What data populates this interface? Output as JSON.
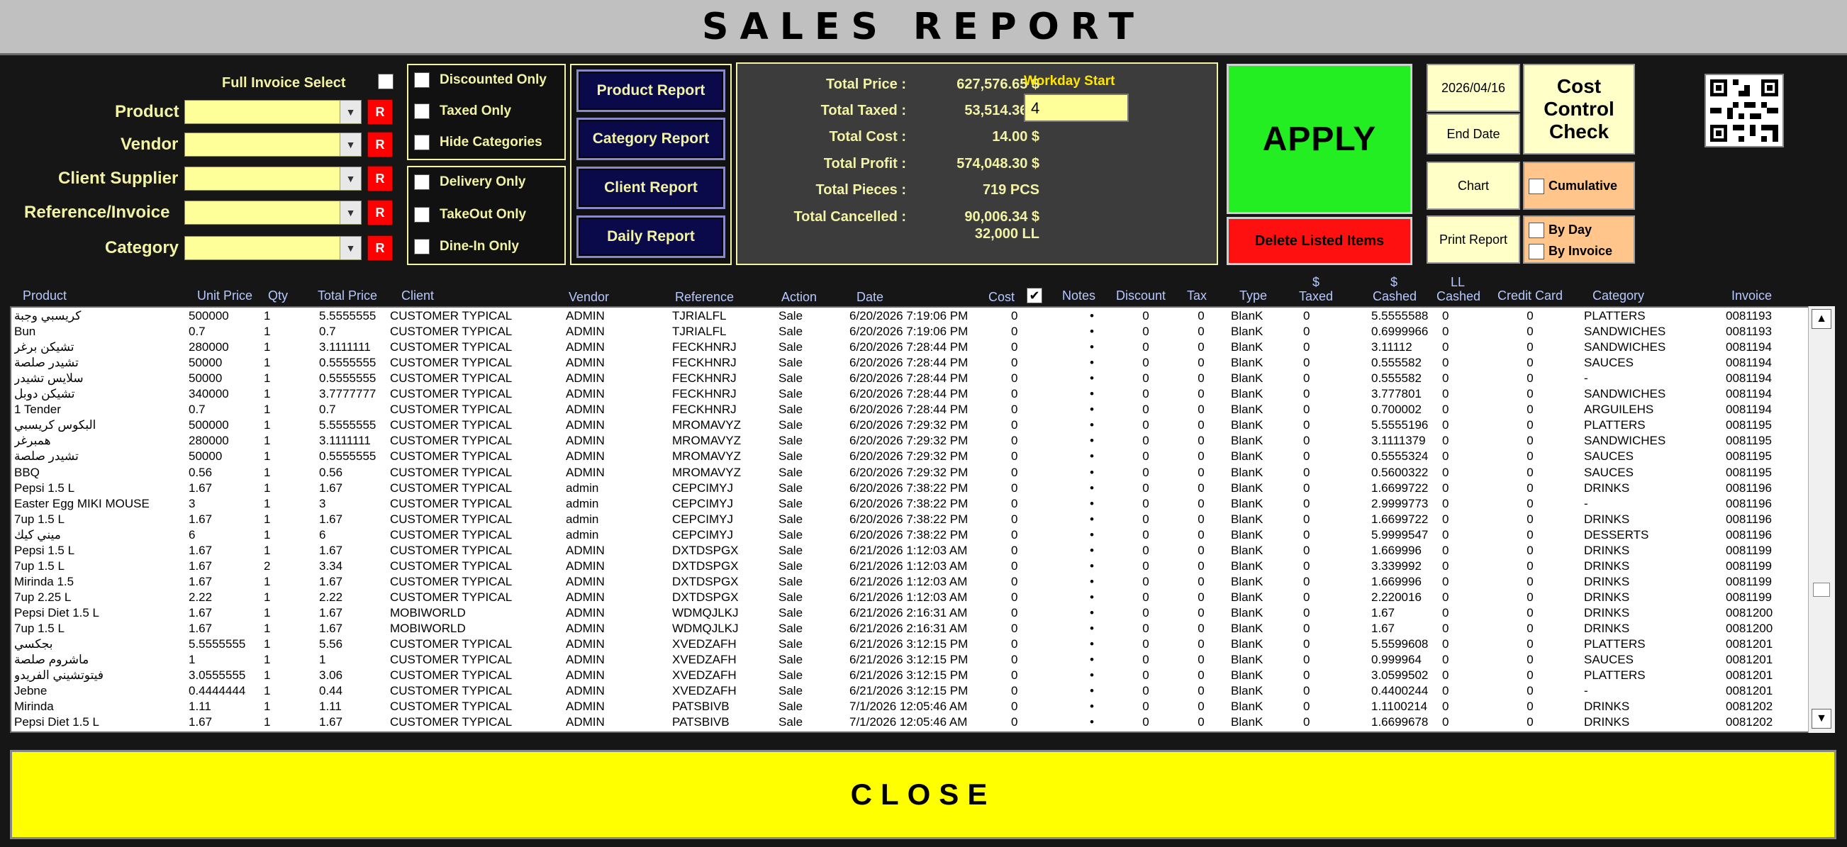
{
  "title": "SALES REPORT",
  "filters": {
    "full_invoice_select": "Full Invoice Select",
    "product": "Product",
    "vendor": "Vendor",
    "client_supplier": "Client Supplier",
    "reference_invoice": "Reference/Invoice",
    "category": "Category",
    "reset_label": "R"
  },
  "checks_group1": [
    "Discounted Only",
    "Taxed Only",
    "Hide Categories"
  ],
  "checks_group2": [
    "Delivery Only",
    "TakeOut Only",
    "Dine-In Only"
  ],
  "reports": [
    "Product Report",
    "Category Report",
    "Client Report",
    "Daily Report"
  ],
  "totals": {
    "price_label": "Total Price :",
    "price": "627,576.65 $",
    "taxed_label": "Total Taxed :",
    "taxed": "53,514.36 $",
    "cost_label": "Total Cost :",
    "cost": "14.00 $",
    "profit_label": "Total Profit :",
    "profit": "574,048.30 $",
    "pieces_label": "Total Pieces :",
    "pieces": "719 PCS",
    "cancelled_label": "Total Cancelled :",
    "cancelled": "90,006.34 $",
    "cancelled_ll": "32,000 LL",
    "workday_label": "Workday Start",
    "workday_value": "4"
  },
  "actions": {
    "apply": "APPLY",
    "delete": "Delete Listed  Items",
    "start_date": "2026/04/16",
    "end_date": "End Date",
    "cost_control": "Cost Control Check",
    "chart": "Chart",
    "cumulative": "Cumulative",
    "print": "Print Report",
    "by_day": "By Day",
    "by_invoice": "By Invoice",
    "close": "CLOSE"
  },
  "table": {
    "headers": [
      "Product",
      "Unit Price",
      "Qty",
      "Total Price",
      "Client",
      "Vendor",
      "Reference",
      "Action",
      "Date",
      "Cost",
      "Notes",
      "Discount",
      "Tax",
      "Type",
      "$ Taxed",
      "$ Cashed",
      "LL Cashed",
      "Credit Card",
      "Category",
      "Invoice"
    ],
    "rows": [
      [
        "كريسبي وجبة",
        "500000",
        "1",
        "5.5555555",
        "CUSTOMER TYPICAL",
        "ADMIN",
        "TJRIALFL",
        "Sale",
        "6/20/2026 7:19:06 PM",
        "0",
        "•",
        "0",
        "0",
        "BlanK",
        "0",
        "5.5555588",
        "0",
        "0",
        "PLATTERS",
        "0081193"
      ],
      [
        "Bun",
        "0.7",
        "1",
        "0.7",
        "CUSTOMER TYPICAL",
        "ADMIN",
        "TJRIALFL",
        "Sale",
        "6/20/2026 7:19:06 PM",
        "0",
        "•",
        "0",
        "0",
        "BlanK",
        "0",
        "0.6999966",
        "0",
        "0",
        "SANDWICHES",
        "0081193"
      ],
      [
        "تشيكن برغر",
        "280000",
        "1",
        "3.1111111",
        "CUSTOMER TYPICAL",
        "ADMIN",
        "FECKHNRJ",
        "Sale",
        "6/20/2026 7:28:44 PM",
        "0",
        "•",
        "0",
        "0",
        "BlanK",
        "0",
        "3.11112",
        "0",
        "0",
        "SANDWICHES",
        "0081194"
      ],
      [
        "تشيدر صلصة",
        "50000",
        "1",
        "0.5555555",
        "CUSTOMER TYPICAL",
        "ADMIN",
        "FECKHNRJ",
        "Sale",
        "6/20/2026 7:28:44 PM",
        "0",
        "•",
        "0",
        "0",
        "BlanK",
        "0",
        "0.555582",
        "0",
        "0",
        "SAUCES",
        "0081194"
      ],
      [
        "سلايس تشيدر",
        "50000",
        "1",
        "0.5555555",
        "CUSTOMER TYPICAL",
        "ADMIN",
        "FECKHNRJ",
        "Sale",
        "6/20/2026 7:28:44 PM",
        "0",
        "•",
        "0",
        "0",
        "BlanK",
        "0",
        "0.555582",
        "0",
        "0",
        "-",
        "0081194"
      ],
      [
        "تشيكن دوبل",
        "340000",
        "1",
        "3.7777777",
        "CUSTOMER TYPICAL",
        "ADMIN",
        "FECKHNRJ",
        "Sale",
        "6/20/2026 7:28:44 PM",
        "0",
        "•",
        "0",
        "0",
        "BlanK",
        "0",
        "3.777801",
        "0",
        "0",
        "SANDWICHES",
        "0081194"
      ],
      [
        "1 Tender",
        "0.7",
        "1",
        "0.7",
        "CUSTOMER TYPICAL",
        "ADMIN",
        "FECKHNRJ",
        "Sale",
        "6/20/2026 7:28:44 PM",
        "0",
        "•",
        "0",
        "0",
        "BlanK",
        "0",
        "0.700002",
        "0",
        "0",
        "ARGUILEHS",
        "0081194"
      ],
      [
        "البكوس كريسبي",
        "500000",
        "1",
        "5.5555555",
        "CUSTOMER TYPICAL",
        "ADMIN",
        "MROMAVYZ",
        "Sale",
        "6/20/2026 7:29:32 PM",
        "0",
        "•",
        "0",
        "0",
        "BlanK",
        "0",
        "5.5555196",
        "0",
        "0",
        "PLATTERS",
        "0081195"
      ],
      [
        "همبرغر",
        "280000",
        "1",
        "3.1111111",
        "CUSTOMER TYPICAL",
        "ADMIN",
        "MROMAVYZ",
        "Sale",
        "6/20/2026 7:29:32 PM",
        "0",
        "•",
        "0",
        "0",
        "BlanK",
        "0",
        "3.1111379",
        "0",
        "0",
        "SANDWICHES",
        "0081195"
      ],
      [
        "تشيدر صلصة",
        "50000",
        "1",
        "0.5555555",
        "CUSTOMER TYPICAL",
        "ADMIN",
        "MROMAVYZ",
        "Sale",
        "6/20/2026 7:29:32 PM",
        "0",
        "•",
        "0",
        "0",
        "BlanK",
        "0",
        "0.5555324",
        "0",
        "0",
        "SAUCES",
        "0081195"
      ],
      [
        "BBQ",
        "0.56",
        "1",
        "0.56",
        "CUSTOMER TYPICAL",
        "ADMIN",
        "MROMAVYZ",
        "Sale",
        "6/20/2026 7:29:32 PM",
        "0",
        "•",
        "0",
        "0",
        "BlanK",
        "0",
        "0.5600322",
        "0",
        "0",
        "SAUCES",
        "0081195"
      ],
      [
        "Pepsi 1.5 L",
        "1.67",
        "1",
        "1.67",
        "CUSTOMER TYPICAL",
        "admin",
        "CEPCIMYJ",
        "Sale",
        "6/20/2026 7:38:22 PM",
        "0",
        "•",
        "0",
        "0",
        "BlanK",
        "0",
        "1.6699722",
        "0",
        "0",
        "DRINKS",
        "0081196"
      ],
      [
        "Easter Egg MIKI MOUSE",
        "3",
        "1",
        "3",
        "CUSTOMER TYPICAL",
        "admin",
        "CEPCIMYJ",
        "Sale",
        "6/20/2026 7:38:22 PM",
        "0",
        "•",
        "0",
        "0",
        "BlanK",
        "0",
        "2.9999773",
        "0",
        "0",
        "-",
        "0081196"
      ],
      [
        "7up 1.5 L",
        "1.67",
        "1",
        "1.67",
        "CUSTOMER TYPICAL",
        "admin",
        "CEPCIMYJ",
        "Sale",
        "6/20/2026 7:38:22 PM",
        "0",
        "•",
        "0",
        "0",
        "BlanK",
        "0",
        "1.6699722",
        "0",
        "0",
        "DRINKS",
        "0081196"
      ],
      [
        "ميني كيك",
        "6",
        "1",
        "6",
        "CUSTOMER TYPICAL",
        "admin",
        "CEPCIMYJ",
        "Sale",
        "6/20/2026 7:38:22 PM",
        "0",
        "•",
        "0",
        "0",
        "BlanK",
        "0",
        "5.9999547",
        "0",
        "0",
        "DESSERTS",
        "0081196"
      ],
      [
        "Pepsi 1.5 L",
        "1.67",
        "1",
        "1.67",
        "CUSTOMER TYPICAL",
        "ADMIN",
        "DXTDSPGX",
        "Sale",
        "6/21/2026 1:12:03 AM",
        "0",
        "•",
        "0",
        "0",
        "BlanK",
        "0",
        "1.669996",
        "0",
        "0",
        "DRINKS",
        "0081199"
      ],
      [
        "7up 1.5 L",
        "1.67",
        "2",
        "3.34",
        "CUSTOMER TYPICAL",
        "ADMIN",
        "DXTDSPGX",
        "Sale",
        "6/21/2026 1:12:03 AM",
        "0",
        "•",
        "0",
        "0",
        "BlanK",
        "0",
        "3.339992",
        "0",
        "0",
        "DRINKS",
        "0081199"
      ],
      [
        "Mirinda 1.5",
        "1.67",
        "1",
        "1.67",
        "CUSTOMER TYPICAL",
        "ADMIN",
        "DXTDSPGX",
        "Sale",
        "6/21/2026 1:12:03 AM",
        "0",
        "•",
        "0",
        "0",
        "BlanK",
        "0",
        "1.669996",
        "0",
        "0",
        "DRINKS",
        "0081199"
      ],
      [
        "7up 2.25 L",
        "2.22",
        "1",
        "2.22",
        "CUSTOMER TYPICAL",
        "ADMIN",
        "DXTDSPGX",
        "Sale",
        "6/21/2026 1:12:03 AM",
        "0",
        "•",
        "0",
        "0",
        "BlanK",
        "0",
        "2.220016",
        "0",
        "0",
        "DRINKS",
        "0081199"
      ],
      [
        "Pepsi Diet 1.5 L",
        "1.67",
        "1",
        "1.67",
        "MOBIWORLD",
        "ADMIN",
        "WDMQJLKJ",
        "Sale",
        "6/21/2026 2:16:31 AM",
        "0",
        "•",
        "0",
        "0",
        "BlanK",
        "0",
        "1.67",
        "0",
        "0",
        "DRINKS",
        "0081200"
      ],
      [
        "7up 1.5 L",
        "1.67",
        "1",
        "1.67",
        "MOBIWORLD",
        "ADMIN",
        "WDMQJLKJ",
        "Sale",
        "6/21/2026 2:16:31 AM",
        "0",
        "•",
        "0",
        "0",
        "BlanK",
        "0",
        "1.67",
        "0",
        "0",
        "DRINKS",
        "0081200"
      ],
      [
        "بجكسي",
        "5.5555555",
        "1",
        "5.56",
        "CUSTOMER TYPICAL",
        "ADMIN",
        "XVEDZAFH",
        "Sale",
        "6/21/2026 3:12:15 PM",
        "0",
        "•",
        "0",
        "0",
        "BlanK",
        "0",
        "5.5599608",
        "0",
        "0",
        "PLATTERS",
        "0081201"
      ],
      [
        "ماشروم صلصة",
        "1",
        "1",
        "1",
        "CUSTOMER TYPICAL",
        "ADMIN",
        "XVEDZAFH",
        "Sale",
        "6/21/2026 3:12:15 PM",
        "0",
        "•",
        "0",
        "0",
        "BlanK",
        "0",
        "0.999964",
        "0",
        "0",
        "SAUCES",
        "0081201"
      ],
      [
        "فيتوتشيني الفريدو",
        "3.0555555",
        "1",
        "3.06",
        "CUSTOMER TYPICAL",
        "ADMIN",
        "XVEDZAFH",
        "Sale",
        "6/21/2026 3:12:15 PM",
        "0",
        "•",
        "0",
        "0",
        "BlanK",
        "0",
        "3.0599502",
        "0",
        "0",
        "PLATTERS",
        "0081201"
      ],
      [
        "Jebne",
        "0.4444444",
        "1",
        "0.44",
        "CUSTOMER TYPICAL",
        "ADMIN",
        "XVEDZAFH",
        "Sale",
        "6/21/2026 3:12:15 PM",
        "0",
        "•",
        "0",
        "0",
        "BlanK",
        "0",
        "0.4400244",
        "0",
        "0",
        "-",
        "0081201"
      ],
      [
        "Mirinda",
        "1.11",
        "1",
        "1.11",
        "CUSTOMER TYPICAL",
        "ADMIN",
        "PATSBIVB",
        "Sale",
        "7/1/2026 12:05:46 AM",
        "0",
        "•",
        "0",
        "0",
        "BlanK",
        "0",
        "1.1100214",
        "0",
        "0",
        "DRINKS",
        "0081202"
      ],
      [
        "Pepsi Diet 1.5 L",
        "1.67",
        "1",
        "1.67",
        "CUSTOMER TYPICAL",
        "ADMIN",
        "PATSBIVB",
        "Sale",
        "7/1/2026 12:05:46 AM",
        "0",
        "•",
        "0",
        "0",
        "BlanK",
        "0",
        "1.6699678",
        "0",
        "0",
        "DRINKS",
        "0081202"
      ]
    ]
  }
}
